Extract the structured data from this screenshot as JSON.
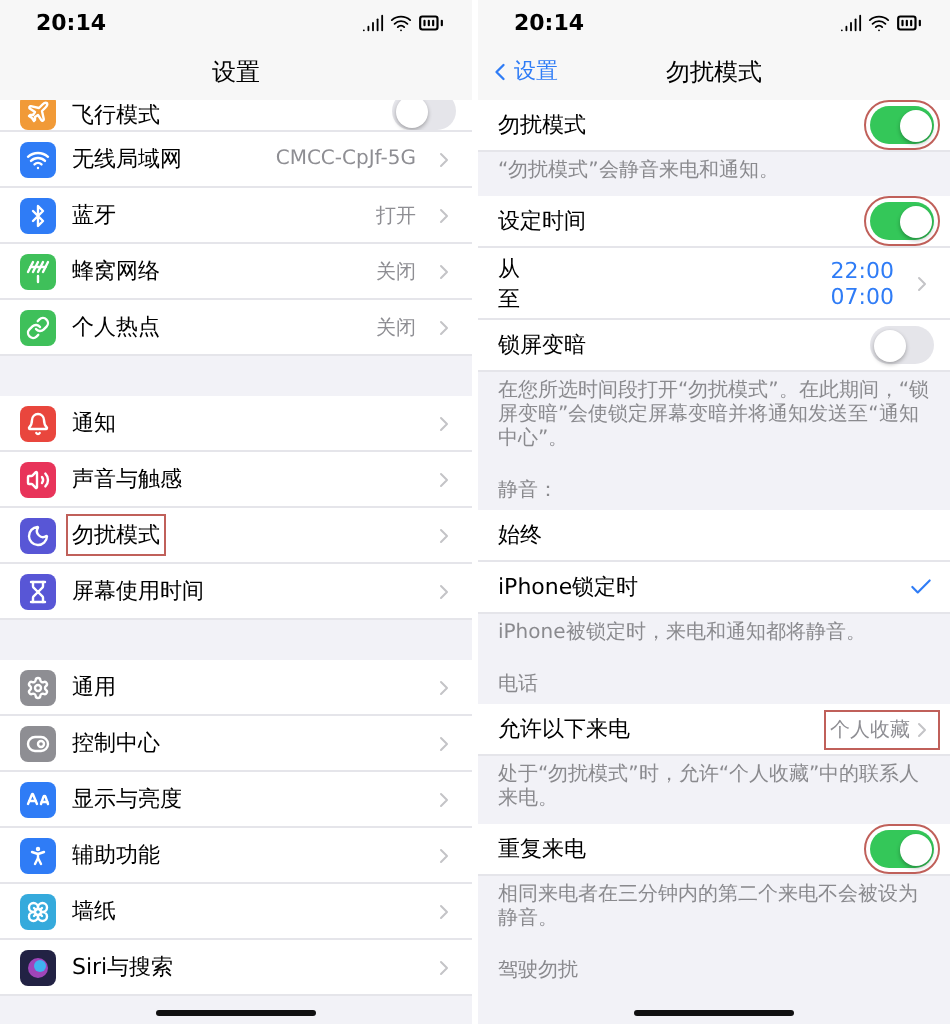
{
  "left": {
    "status_time": "20:14",
    "title": "设置",
    "groups": [
      [
        {
          "label": "飞行模式",
          "color": "#f19a37",
          "toggle": false
        },
        {
          "label": "无线局域网",
          "color": "#2f7cf6",
          "value": "CMCC-CpJf-5G"
        },
        {
          "label": "蓝牙",
          "color": "#2f7cf6",
          "value": "打开"
        },
        {
          "label": "蜂窝网络",
          "color": "#3fc05a",
          "value": "关闭"
        },
        {
          "label": "个人热点",
          "color": "#3fc05a",
          "value": "关闭"
        }
      ],
      [
        {
          "label": "通知",
          "color": "#e9463d"
        },
        {
          "label": "声音与触感",
          "color": "#e8345a"
        },
        {
          "label": "勿扰模式",
          "color": "#5856d6",
          "highlighted": true
        },
        {
          "label": "屏幕使用时间",
          "color": "#5856d6"
        }
      ],
      [
        {
          "label": "通用",
          "color": "#8e8e93"
        },
        {
          "label": "控制中心",
          "color": "#8e8e93"
        },
        {
          "label": "显示与亮度",
          "color": "#2f7cf6"
        },
        {
          "label": "辅助功能",
          "color": "#2f7cf6"
        },
        {
          "label": "墙纸",
          "color": "#35aadc"
        },
        {
          "label": "Siri与搜索",
          "color": "#222244"
        }
      ]
    ]
  },
  "right": {
    "status_time": "20:14",
    "back": "设置",
    "title": "勿扰模式",
    "sections": [
      {
        "kind": "row",
        "label": "勿扰模式",
        "toggle": true,
        "highlighted": true
      },
      {
        "kind": "note",
        "text": "“勿扰模式”会静音来电和通知。"
      },
      {
        "kind": "row",
        "label": "设定时间",
        "toggle": true,
        "highlighted": true
      },
      {
        "kind": "range",
        "from_label": "从",
        "to_label": "至",
        "from": "22:00",
        "to": "07:00"
      },
      {
        "kind": "row",
        "label": "锁屏变暗",
        "toggle": false
      },
      {
        "kind": "note",
        "text": "在您所选时间段打开“勿扰模式”。在此期间，“锁屏变暗”会使锁定屏幕变暗并将通知发送至“通知中心”。"
      },
      {
        "kind": "header",
        "text": "静音："
      },
      {
        "kind": "choice",
        "label": "始终",
        "selected": false
      },
      {
        "kind": "choice",
        "label": "iPhone锁定时",
        "selected": true
      },
      {
        "kind": "note",
        "text": "iPhone被锁定时，来电和通知都将静音。"
      },
      {
        "kind": "header",
        "text": "电话"
      },
      {
        "kind": "row",
        "label": "允许以下来电",
        "value": "个人收藏",
        "highlighted": true
      },
      {
        "kind": "note",
        "text": "处于“勿扰模式”时，允许“个人收藏”中的联系人来电。"
      },
      {
        "kind": "row",
        "label": "重复来电",
        "toggle": true,
        "highlighted": true
      },
      {
        "kind": "note",
        "text": "相同来电者在三分钟内的第二个来电不会被设为静音。"
      },
      {
        "kind": "header",
        "text": "驾驶勿扰"
      }
    ]
  }
}
